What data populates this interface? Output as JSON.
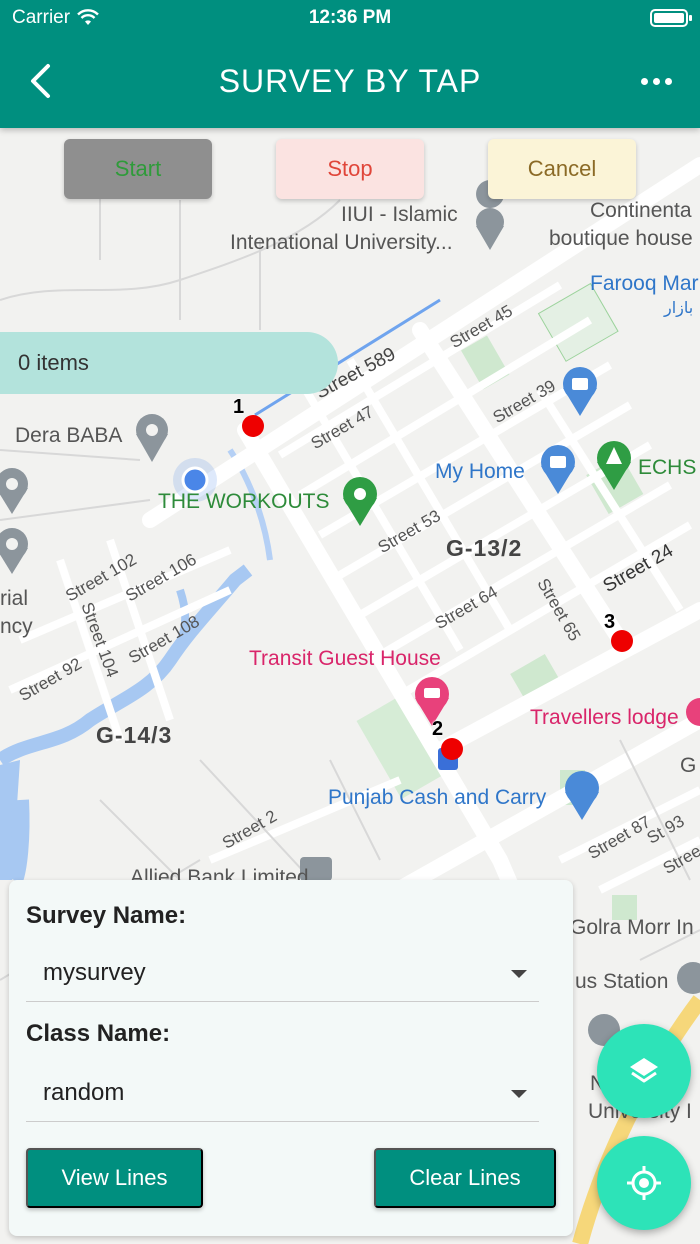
{
  "status_bar": {
    "carrier": "Carrier",
    "time": "12:36 PM"
  },
  "app_bar": {
    "title": "SURVEY BY TAP"
  },
  "controls": {
    "start": "Start",
    "stop": "Stop",
    "cancel": "Cancel"
  },
  "items_count": "0 items",
  "markers": [
    {
      "label": "1"
    },
    {
      "label": "2"
    },
    {
      "label": "3"
    }
  ],
  "map_labels": {
    "places": [
      "IIUI - Islamic",
      "Intenational University...",
      "Continenta",
      "boutique house",
      "Farooq Mar",
      "بازار",
      "Dera BABA",
      "THE WORKOUTS",
      "My Home",
      "ECHS",
      "Transit Guest House",
      "Travellers lodge",
      "Punjab Cash and Carry",
      "Allied Bank Limited",
      "Golra Morr In",
      "us Station",
      "rial",
      "ncy",
      "N",
      "University I",
      "G"
    ],
    "roads": [
      "Street 589",
      "Street 45",
      "Street 47",
      "Street 39",
      "Street 53",
      "Street 24",
      "Street 64",
      "Street 65",
      "Street 102",
      "Street 106",
      "Street 104",
      "Street 108",
      "Street 92",
      "Street 2",
      "Street 87",
      "St 93",
      "Stree"
    ],
    "sectors": [
      "G-13/2",
      "G-14/3"
    ]
  },
  "form": {
    "survey_label": "Survey Name:",
    "survey_value": "mysurvey",
    "class_label": "Class Name:",
    "class_value": "random",
    "view_lines": "View Lines",
    "clear_lines": "Clear Lines"
  },
  "icons": {
    "back": "chevron-left-icon",
    "more": "more-dots-icon",
    "layers": "layers-icon",
    "location": "my-location-icon"
  },
  "colors": {
    "primary": "#008f7f",
    "fab": "#2de3b8",
    "marker": "#ee0000",
    "items_pill": "#b3e3dc"
  }
}
